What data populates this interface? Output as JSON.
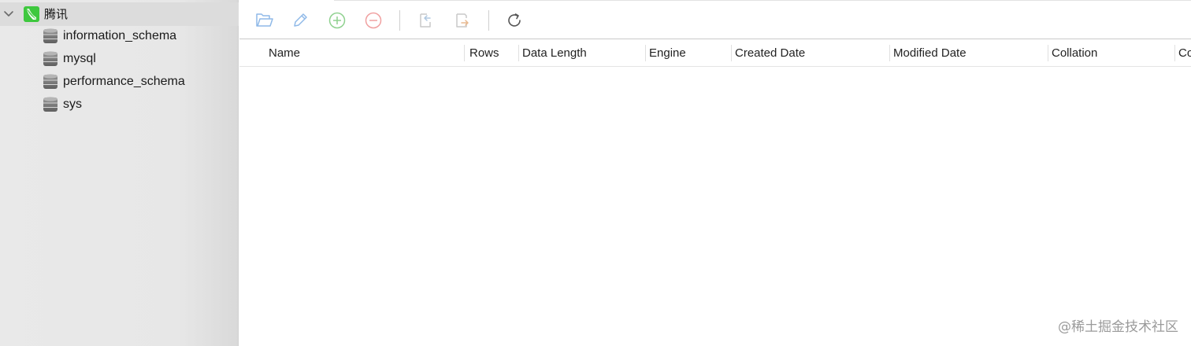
{
  "sidebar": {
    "connection": {
      "label": "腾讯",
      "icon": "connection-icon",
      "expanded": true,
      "accent": "#3ec83e"
    },
    "databases": [
      {
        "label": "information_schema",
        "icon": "database-icon"
      },
      {
        "label": "mysql",
        "icon": "database-icon"
      },
      {
        "label": "performance_schema",
        "icon": "database-icon"
      },
      {
        "label": "sys",
        "icon": "database-icon"
      }
    ]
  },
  "toolbar": {
    "buttons": [
      {
        "name": "open-table-button",
        "icon": "folder-open-icon",
        "color": "#8fb9e8"
      },
      {
        "name": "design-table-button",
        "icon": "pencil-icon",
        "color": "#8fb9e8"
      },
      {
        "name": "new-table-button",
        "icon": "plus-circle-icon",
        "color": "#8fd18f"
      },
      {
        "name": "delete-table-button",
        "icon": "minus-circle-icon",
        "color": "#f0a0a0"
      },
      {
        "name": "import-button",
        "icon": "import-icon",
        "color": "#c9c9c9"
      },
      {
        "name": "export-button",
        "icon": "export-icon",
        "color": "#e8b98f"
      },
      {
        "name": "refresh-button",
        "icon": "refresh-icon",
        "color": "#555555"
      }
    ]
  },
  "table": {
    "columns": [
      "Name",
      "Rows",
      "Data Length",
      "Engine",
      "Created Date",
      "Modified Date",
      "Collation",
      "Co"
    ],
    "rows": []
  },
  "watermark": "@稀土掘金技术社区"
}
